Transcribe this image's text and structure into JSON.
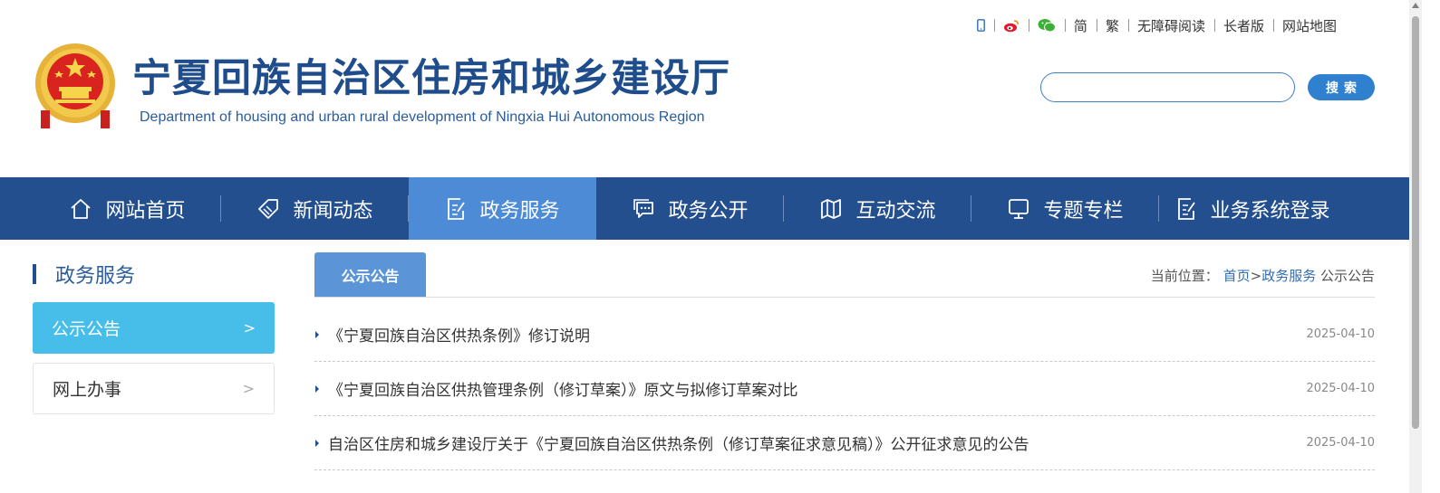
{
  "header": {
    "title": "宁夏回族自治区住房和城乡建设厅",
    "subtitle": "Department of housing and urban rural development of Ningxia Hui Autonomous Region"
  },
  "toplinks": [
    {
      "icon": "mobile-icon"
    },
    {
      "icon": "weibo-icon"
    },
    {
      "icon": "wechat-icon"
    },
    {
      "label": "简"
    },
    {
      "label": "繁"
    },
    {
      "label": "无障碍阅读"
    },
    {
      "label": "长者版"
    },
    {
      "label": "网站地图"
    }
  ],
  "search": {
    "placeholder": "",
    "button_label": "搜索"
  },
  "nav": [
    {
      "label": "网站首页",
      "icon": "home-icon"
    },
    {
      "label": "新闻动态",
      "icon": "tag-icon"
    },
    {
      "label": "政务服务",
      "icon": "edit-document-icon",
      "active": true
    },
    {
      "label": "政务公开",
      "icon": "chat-icon"
    },
    {
      "label": "互动交流",
      "icon": "map-icon"
    },
    {
      "label": "专题专栏",
      "icon": "monitor-icon"
    },
    {
      "label": "业务系统登录",
      "icon": "document-icon"
    }
  ],
  "sidebar": {
    "title": "政务服务",
    "items": [
      {
        "label": "公示公告",
        "arrow": ">",
        "active": true
      },
      {
        "label": "网上办事",
        "arrow": ">"
      }
    ]
  },
  "main": {
    "tab_label": "公示公告",
    "breadcrumb": {
      "prefix": "当前位置：",
      "links": [
        "首页",
        "政务服务"
      ],
      "separator": ">",
      "current": "公示公告"
    },
    "items": [
      {
        "title": "《宁夏回族自治区供热条例》修订说明",
        "date": "2025-04-10"
      },
      {
        "title": "《宁夏回族自治区供热管理条例（修订草案）》原文与拟修订草案对比",
        "date": "2025-04-10"
      },
      {
        "title": "自治区住房和城乡建设厅关于《宁夏回族自治区供热条例（修订草案征求意见稿）》公开征求意见的公告",
        "date": "2025-04-10"
      }
    ]
  },
  "colors": {
    "nav_bg": "#234f8e",
    "nav_active": "#4d8bd6",
    "sidebar_active": "#47bde9",
    "title_blue": "#1f4d8c",
    "search_button": "#2f80cf"
  }
}
